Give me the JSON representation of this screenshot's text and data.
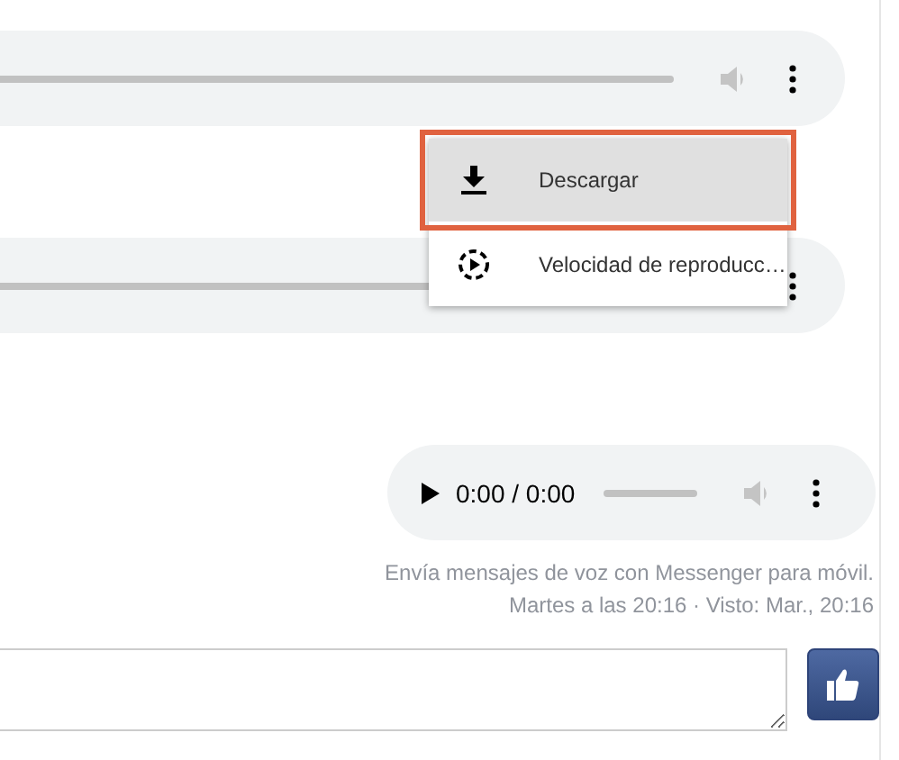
{
  "audio_players": [
    {
      "kind": "cropped",
      "level": 0
    },
    {
      "kind": "covered",
      "level": 0
    },
    {
      "kind": "full",
      "time": "0:00 / 0:00",
      "level": 0
    }
  ],
  "menu": {
    "items": [
      {
        "kind": "download",
        "label": "Descargar",
        "selected": true
      },
      {
        "kind": "speed",
        "label": "Velocidad de reproducc…",
        "selected": false
      }
    ]
  },
  "notice": "Envía mensajes de voz con Messenger para móvil.",
  "status": "Martes a las 20:16 · Visto: Mar., 20:16"
}
